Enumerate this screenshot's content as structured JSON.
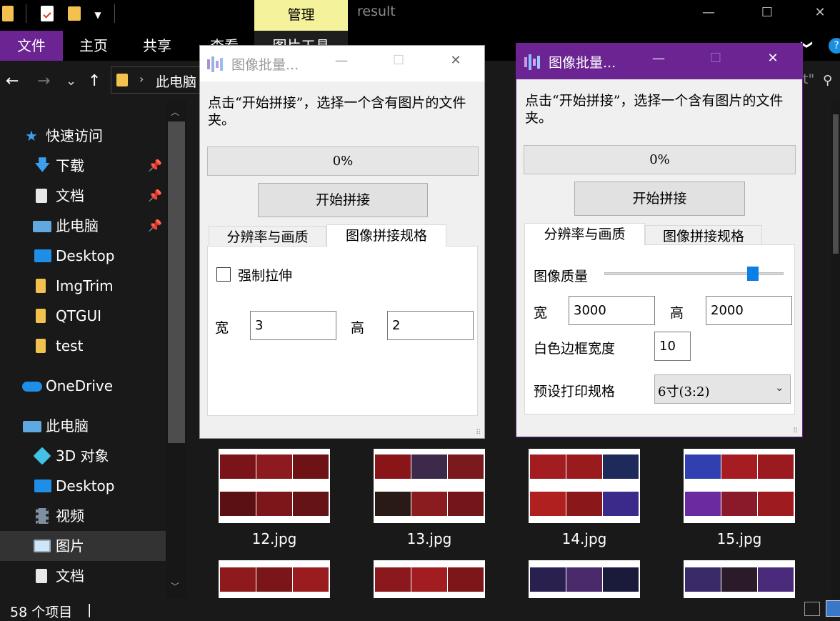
{
  "titlebar": {
    "context_tab": "管理",
    "window_title": "result",
    "minimize": "—",
    "maximize": "☐",
    "close": "✕"
  },
  "ribbon": {
    "tabs": [
      "文件",
      "主页",
      "共享",
      "查看",
      "图片工具"
    ],
    "expand": "❯"
  },
  "nav": {
    "back": "←",
    "forward": "→",
    "recent": "⌄",
    "up": "↑",
    "chevron": "›",
    "address": "此电脑",
    "search_tail": "t\"",
    "search_icon": "⚲"
  },
  "sidebar": {
    "items": [
      {
        "label": "快速访问",
        "icon": "star-icon",
        "pinned": false
      },
      {
        "label": "下载",
        "icon": "download-icon",
        "pinned": true
      },
      {
        "label": "文档",
        "icon": "document-icon",
        "pinned": true
      },
      {
        "label": "此电脑",
        "icon": "computer-icon",
        "pinned": true
      },
      {
        "label": "Desktop",
        "icon": "desktop-icon",
        "pinned": false
      },
      {
        "label": "ImgTrim",
        "icon": "folder-icon",
        "pinned": false
      },
      {
        "label": "QTGUI",
        "icon": "folder-icon",
        "pinned": false
      },
      {
        "label": "test",
        "icon": "folder-icon",
        "pinned": false
      },
      {
        "label": "OneDrive",
        "icon": "cloud-icon",
        "pinned": false
      },
      {
        "label": "此电脑",
        "icon": "computer-icon",
        "pinned": false
      },
      {
        "label": "3D 对象",
        "icon": "cube-icon",
        "pinned": false
      },
      {
        "label": "Desktop",
        "icon": "desktop-icon",
        "pinned": false
      },
      {
        "label": "视频",
        "icon": "video-icon",
        "pinned": false
      },
      {
        "label": "图片",
        "icon": "pictures-icon",
        "pinned": false
      },
      {
        "label": "文档",
        "icon": "document-icon",
        "pinned": false
      }
    ],
    "pin_glyph": "📌"
  },
  "files": [
    {
      "name": "12.jpg"
    },
    {
      "name": "13.jpg"
    },
    {
      "name": "14.jpg"
    },
    {
      "name": "15.jpg"
    }
  ],
  "status": {
    "count": "58 个项目",
    "caret": "|"
  },
  "dialog_left": {
    "title": "图像批量...",
    "description": "点击“开始拼接”，选择一个含有图片的文件夹。",
    "progress": "0%",
    "start_button": "开始拼接",
    "tabs": [
      "分辨率与画质",
      "图像拼接规格"
    ],
    "force_stretch": "强制拉伸",
    "width_label": "宽",
    "width_value": "3",
    "height_label": "高",
    "height_value": "2"
  },
  "dialog_right": {
    "title": "图像批量...",
    "description": "点击“开始拼接”，选择一个含有图片的文件夹。",
    "progress": "0%",
    "start_button": "开始拼接",
    "tabs": [
      "分辨率与画质",
      "图像拼接规格"
    ],
    "quality_label": "图像质量",
    "quality_level": 0.83,
    "width_label": "宽",
    "width_value": "3000",
    "height_label": "高",
    "height_value": "2000",
    "border_label": "白色边框宽度",
    "border_value": "10",
    "preset_label": "预设打印规格",
    "preset_value": "6寸(3:2)"
  },
  "colors": {
    "accent_purple": "#6b2492",
    "context_yellow": "#f4f29a",
    "slider_blue": "#0a7fe5"
  }
}
